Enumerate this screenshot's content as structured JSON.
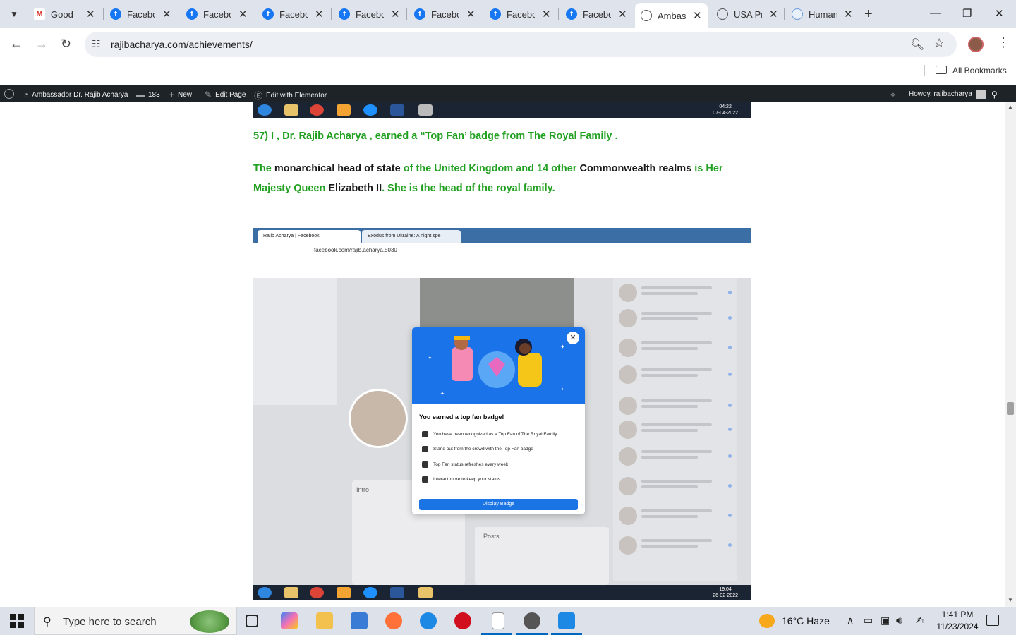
{
  "browser": {
    "tabs": [
      {
        "title": "Good ",
        "icon": "gmail-icon"
      },
      {
        "title": "Facebo",
        "icon": "facebook-icon"
      },
      {
        "title": "Facebo",
        "icon": "facebook-icon"
      },
      {
        "title": "Facebo",
        "icon": "facebook-icon"
      },
      {
        "title": "Facebo",
        "icon": "facebook-icon"
      },
      {
        "title": "Facebo",
        "icon": "facebook-icon"
      },
      {
        "title": "Facebo",
        "icon": "facebook-icon"
      },
      {
        "title": "Facebo",
        "icon": "facebook-icon"
      },
      {
        "title": "Ambas",
        "icon": "globe-icon",
        "active": true
      },
      {
        "title": "USA Pr",
        "icon": "globe-icon"
      },
      {
        "title": "Human",
        "icon": "globe-icon"
      }
    ],
    "url": "rajibacharya.com/achievements/",
    "bookmarks_label": "All Bookmarks"
  },
  "wp_admin": {
    "site_name": "Ambassador Dr. Rajib Acharya",
    "comments_count": "183",
    "new_label": "New",
    "edit_page_label": "Edit Page",
    "elementor_label": "Edit with Elementor",
    "howdy": "Howdy, rajibacharya"
  },
  "content": {
    "top_clock_time": "04:22",
    "top_clock_date": "07-04-2022",
    "heading": "57)  I , Dr. Rajib Acharya ,  earned  a  “Top Fan’ badge  from The Royal Family .",
    "para": [
      {
        "t": "The ",
        "c": "g"
      },
      {
        "t": "monarchical head of state ",
        "c": "k"
      },
      {
        "t": "of the United Kingdom and 14 other ",
        "c": "g"
      },
      {
        "t": "Commonwealth realms ",
        "c": "k"
      },
      {
        "t": "is Her Majesty Queen ",
        "c": "g"
      },
      {
        "t": "Elizabeth II",
        "c": "k"
      },
      {
        "t": ". She is the head of the royal family.",
        "c": "g"
      }
    ],
    "screenshot": {
      "tab1": "Rajib Acharya | Facebook",
      "tab2": "Exodus from Ukraine: A night spe",
      "url": "facebook.com/rajib.acharya.5030",
      "intro_label": "Intro",
      "posts_label": "Posts",
      "modal": {
        "title": "You earned a top fan badge!",
        "items": [
          "You have been recognized as a Top Fan of The Royal Family",
          "Stand out from the crowd with the Top Fan badge",
          "Top Fan status refreshes every week",
          "Interact more to keep your status"
        ],
        "button": "Display Badge"
      },
      "clock_time": "19:04",
      "clock_date": "26-02-2022"
    }
  },
  "taskbar": {
    "search_placeholder": "Type here to search",
    "weather": "16°C  Haze",
    "time": "1:41 PM",
    "date": "11/23/2024"
  }
}
